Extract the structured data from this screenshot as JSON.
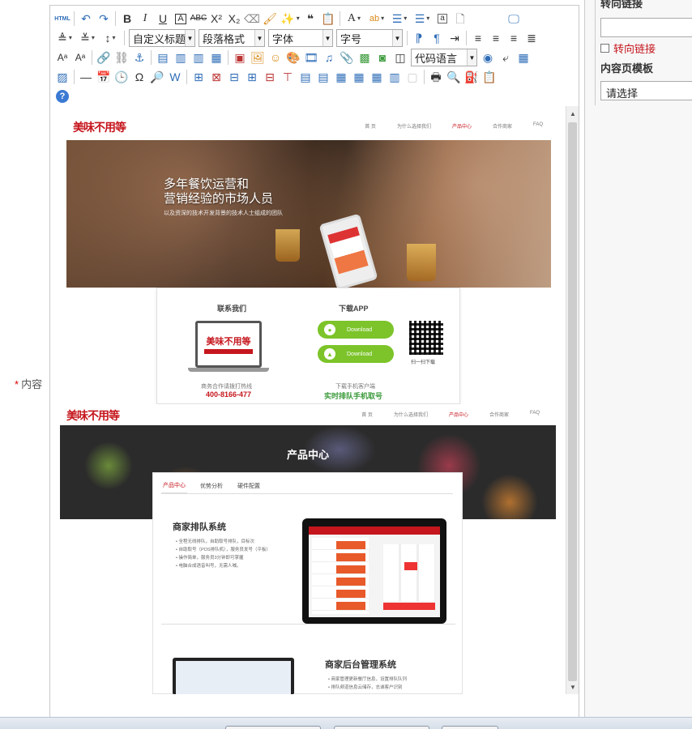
{
  "form": {
    "content_label": "内容",
    "required_mark": "*"
  },
  "toolbar": {
    "html_label": "HTML",
    "selects": {
      "title": "自定义标题",
      "paragraph": "段落格式",
      "font": "字体",
      "size": "字号",
      "code": "代码语言"
    }
  },
  "sidebar": {
    "redirect_title": "转向链接",
    "redirect_checkbox_label": "转向链接",
    "template_title": "内容页模板",
    "template_select": "请选择"
  },
  "preview1": {
    "logo": "美味不用等",
    "nav": [
      "首 页",
      "为什么选择我们",
      "产品中心",
      "合作商家",
      "FAQ"
    ],
    "hero_title_1": "多年餐饮运营和",
    "hero_title_2": "营销经验的市场人员",
    "hero_sub": "以及资深的技术开发背景的技术人士组成的团队",
    "contact_title": "联系我们",
    "download_title": "下载APP",
    "download_btn_1": "Download",
    "download_btn_2": "Download",
    "qr_caption": "扫一扫下载",
    "laptop_logo": "美味不用等",
    "hotline_label": "商务合作请拨打热线",
    "hotline": "400-8166-477",
    "client_label": "下载手机客户端",
    "client_line": "实时排队手机取号"
  },
  "preview2": {
    "logo": "美味不用等",
    "nav": [
      "首 页",
      "为什么选择我们",
      "产品中心",
      "合作商家",
      "FAQ"
    ],
    "banner_title": "产品中心",
    "tabs": [
      "产品中心",
      "优势分析",
      "硬件配置"
    ],
    "system1_title": "商家排队系统",
    "system1_bullets": [
      "全程无线排队，自助取号排队，目标次",
      "自助取号（POS排队机），服务员发号（平板）",
      "操作简单，服务员3分钟即可掌握",
      "电脑合成语音叫号，无需人喊。"
    ],
    "system2_title": "商家后台管理系统",
    "system2_bullets": [
      "商家管理更新餐厅信息，设置排队队列",
      "排队频道信息云储存，志诚客户识别"
    ]
  }
}
